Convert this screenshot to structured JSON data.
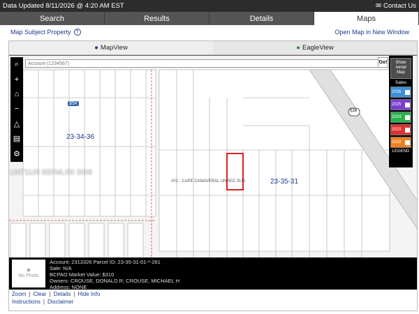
{
  "topbar": {
    "updated": "Data Updated 8/11/2026 @ 4:20 AM EST",
    "contact": "Contact Us"
  },
  "tabs": [
    "Search",
    "Results",
    "Details",
    "Maps"
  ],
  "subrow": {
    "map_subject": "Map Subject Property",
    "open_map": "Open Map in New Window"
  },
  "view_tabs": {
    "map": "MapView",
    "eagle": "EagleView"
  },
  "search": {
    "placeholder": "Account (1234567)",
    "go": "Go!"
  },
  "aerial": "Show Aerial Map",
  "sales": {
    "title": "Sales",
    "years": [
      {
        "label": "2026",
        "color": "#3b8fd8"
      },
      {
        "label": "2025",
        "color": "#7a3fd0"
      },
      {
        "label": "2024",
        "color": "#2bb24c"
      },
      {
        "label": "2023",
        "color": "#e03030"
      },
      {
        "label": "2022",
        "color": "#f08020"
      }
    ],
    "legend": "LEGEND"
  },
  "watermark": "12071129  SEFMLS© 2026",
  "map_labels": {
    "section_left": "23-34-36",
    "section_right": "23-35-31",
    "subdivision": "#01 - CAPE CANAVERAL UNREC SUB",
    "price_badge": "$5K",
    "road": "528"
  },
  "info": {
    "no_photo": "No Photo",
    "account": "Account: 2313326   Parcel ID: 23-35-31-01-*-261",
    "sale": "Sale: N/A",
    "market": "BCPAO Market Value: $310",
    "owners": "Owners: CROUSE, DONALD R; CROUSE, MICHAEL H",
    "address": "Address: NONE"
  },
  "links": {
    "zoom": "Zoom",
    "clear": "Clear",
    "details": "Details",
    "hide_info": "Hide Info",
    "instructions": "Instructions",
    "disclaimer": "Disclaimer"
  }
}
